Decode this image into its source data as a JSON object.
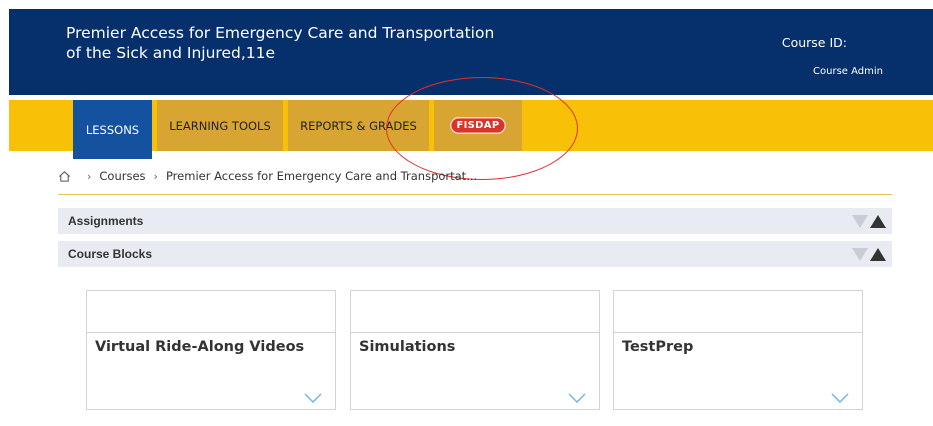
{
  "header": {
    "title_line1": "Premier Access for Emergency Care and Transportation",
    "title_line2": "of the Sick and Injured,11e",
    "course_id_label": "Course ID:",
    "role": "Course Admin"
  },
  "nav": {
    "tabs": [
      {
        "label": "LESSONS",
        "active": true
      },
      {
        "label": "LEARNING TOOLS",
        "active": false
      },
      {
        "label": "REPORTS & GRADES",
        "active": false
      },
      {
        "label": "FISDAP",
        "active": false
      }
    ]
  },
  "breadcrumb": {
    "items": [
      "Courses",
      "Premier Access for Emergency Care and Transportat..."
    ]
  },
  "sections": [
    {
      "label": "Assignments"
    },
    {
      "label": "Course Blocks"
    }
  ],
  "cards": [
    {
      "title": "Virtual Ride-Along Videos"
    },
    {
      "title": "Simulations"
    },
    {
      "title": "TestPrep"
    }
  ],
  "colors": {
    "header_bg": "#05306b",
    "nav_bg": "#f8c006",
    "tab_bg": "#d8a533",
    "active_tab_bg": "#1452a0",
    "fisdap_logo": "#d8342a",
    "annotation": "#e52e2e",
    "chevron": "#6fb3e8"
  },
  "icons": [
    "home-icon",
    "chevron-right-icon",
    "triangle-down-icon",
    "triangle-up-icon",
    "chevron-down-icon",
    "fisdap-logo"
  ]
}
